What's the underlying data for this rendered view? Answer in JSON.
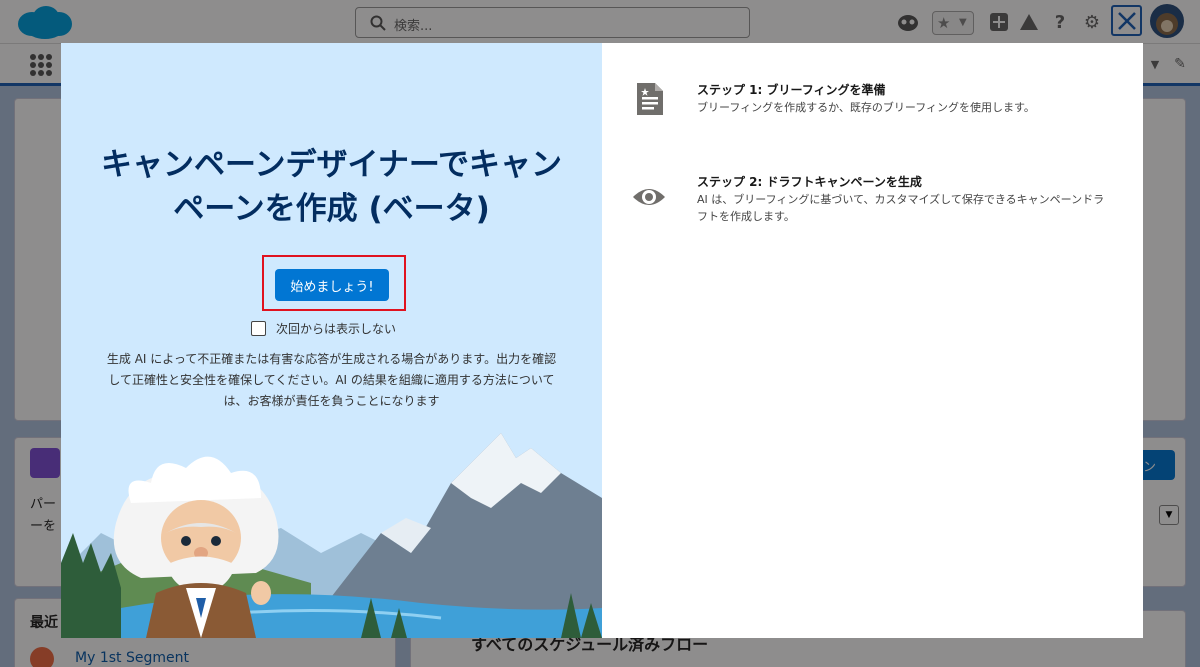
{
  "header": {
    "search_placeholder": "検索..."
  },
  "background": {
    "card_fragment_1": "パー",
    "card_fragment_2": "ーを",
    "recent_fragment": "最近",
    "recent_item": "My 1st Segment",
    "flow_fragment": "すべてのスケジュール済みフロー",
    "button_fragment": "ン"
  },
  "modal": {
    "title": "キャンペーンデザイナーでキャンペーンを作成 (ベータ)",
    "start_button": "始めましょう!",
    "dont_show_label": "次回からは表示しない",
    "disclaimer": "生成 AI によって不正確または有害な応答が生成される場合があります。出力を確認して正確性と安全性を確保してください。AI の結果を組織に適用する方法については、お客様が責任を負うことになります",
    "steps": [
      {
        "icon": "document-icon",
        "title": "ステップ 1: ブリーフィングを準備",
        "description": "ブリーフィングを作成するか、既存のブリーフィングを使用します。"
      },
      {
        "icon": "eye-icon",
        "title": "ステップ 2: ドラフトキャンペーンを生成",
        "description": "AI は、ブリーフィングに基づいて、カスタマイズして保存できるキャンペーンドラフトを作成します。"
      }
    ]
  },
  "colors": {
    "primary": "#0176d3",
    "title": "#032d60",
    "highlight": "#e0121f",
    "left_panel": "#cfe9fe"
  }
}
